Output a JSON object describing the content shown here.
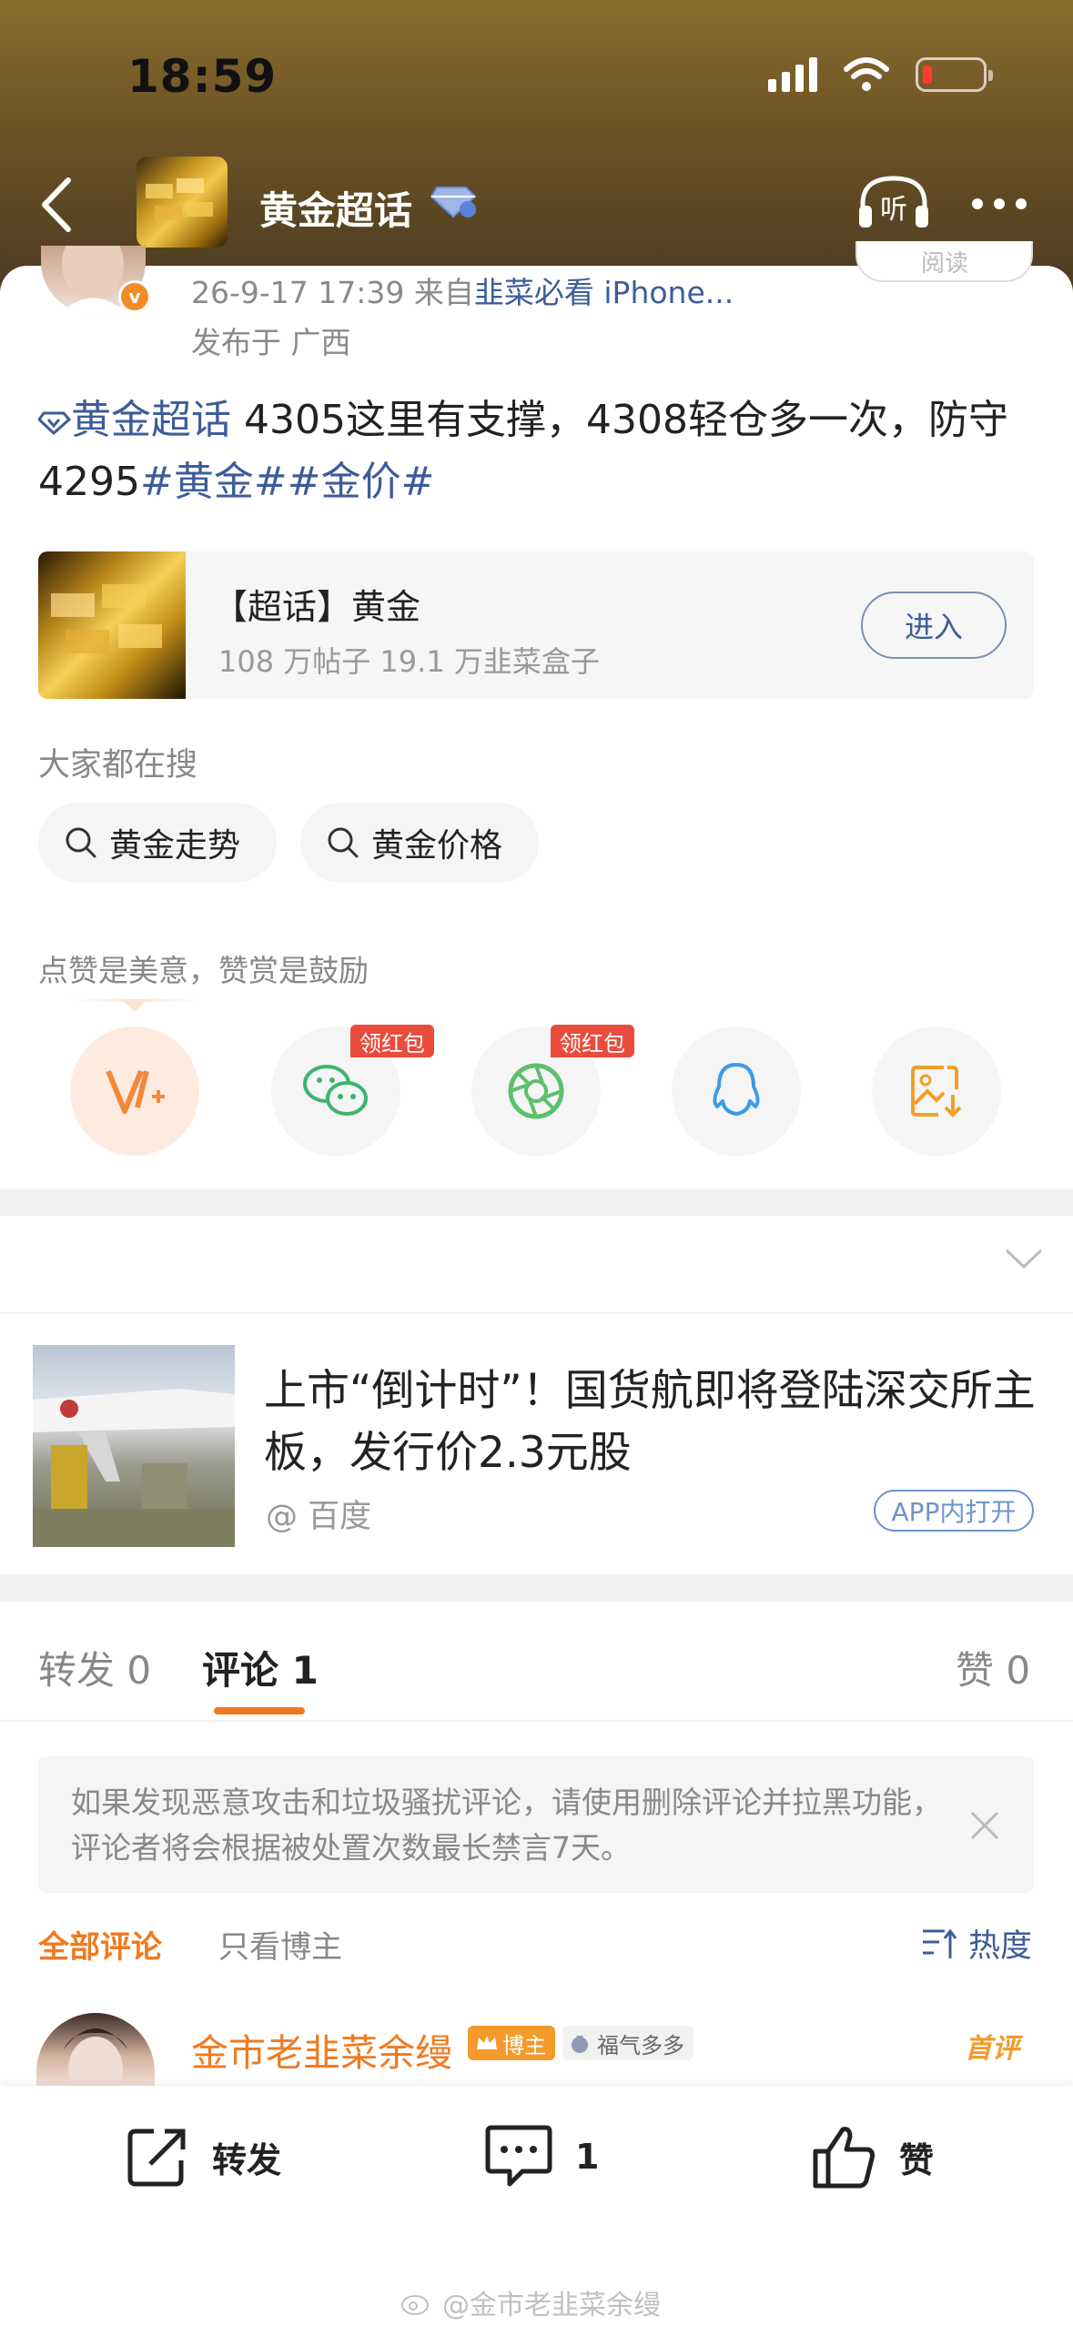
{
  "status_bar": {
    "time": "18:59"
  },
  "nav": {
    "title": "黄金超话"
  },
  "post": {
    "meta_time": "26-9-17 17:39",
    "meta_from_prefix": "来自",
    "meta_source": "韭菜必看 iPhone...",
    "meta_location": "发布于 广西",
    "follow_label": "阅读",
    "topic_tag": "黄金超话",
    "text_body": " 4305这里有支撑，4308轻仓多一次，防守4295",
    "hashtags": "#黄金##金价#"
  },
  "topic_card": {
    "title": "【超话】黄金",
    "stats": "108 万帖子 19.1 万韭菜盒子",
    "enter_label": "进入"
  },
  "trending": {
    "label": "大家都在搜",
    "chips": [
      "黄金走势",
      "黄金价格"
    ]
  },
  "reward": {
    "label": "点赞是美意，赞赏是鼓励",
    "red_packet_label": "领红包"
  },
  "ad": {
    "title": "上市“倒计时”！国货航即将登陆深交所主板，发行价2.3元股",
    "source": "@ 百度",
    "open_label": "APP内打开"
  },
  "tabs": {
    "repost": "转发 0",
    "comment": "评论 1",
    "like": "赞 0"
  },
  "notice": {
    "text": "如果发现恶意攻击和垃圾骚扰评论，请使用删除评论并拉黑功能，评论者将会根据被处置次数最长禁言7天。"
  },
  "filters": {
    "all": "全部评论",
    "blogger_only": "只看博主",
    "sort": "热度"
  },
  "comment": {
    "author": "金市老韭菜余缦",
    "blogger_badge": "博主",
    "luck_badge": "福气多多",
    "first_label": "首评"
  },
  "bottom_bar": {
    "repost": "转发",
    "comment_count": "1",
    "like": "赞"
  },
  "watermark": "@金市老韭菜余缦",
  "colors": {
    "accent_orange": "#f07a20",
    "link_blue": "#3d5c99",
    "red_packet": "#e94c3d"
  }
}
